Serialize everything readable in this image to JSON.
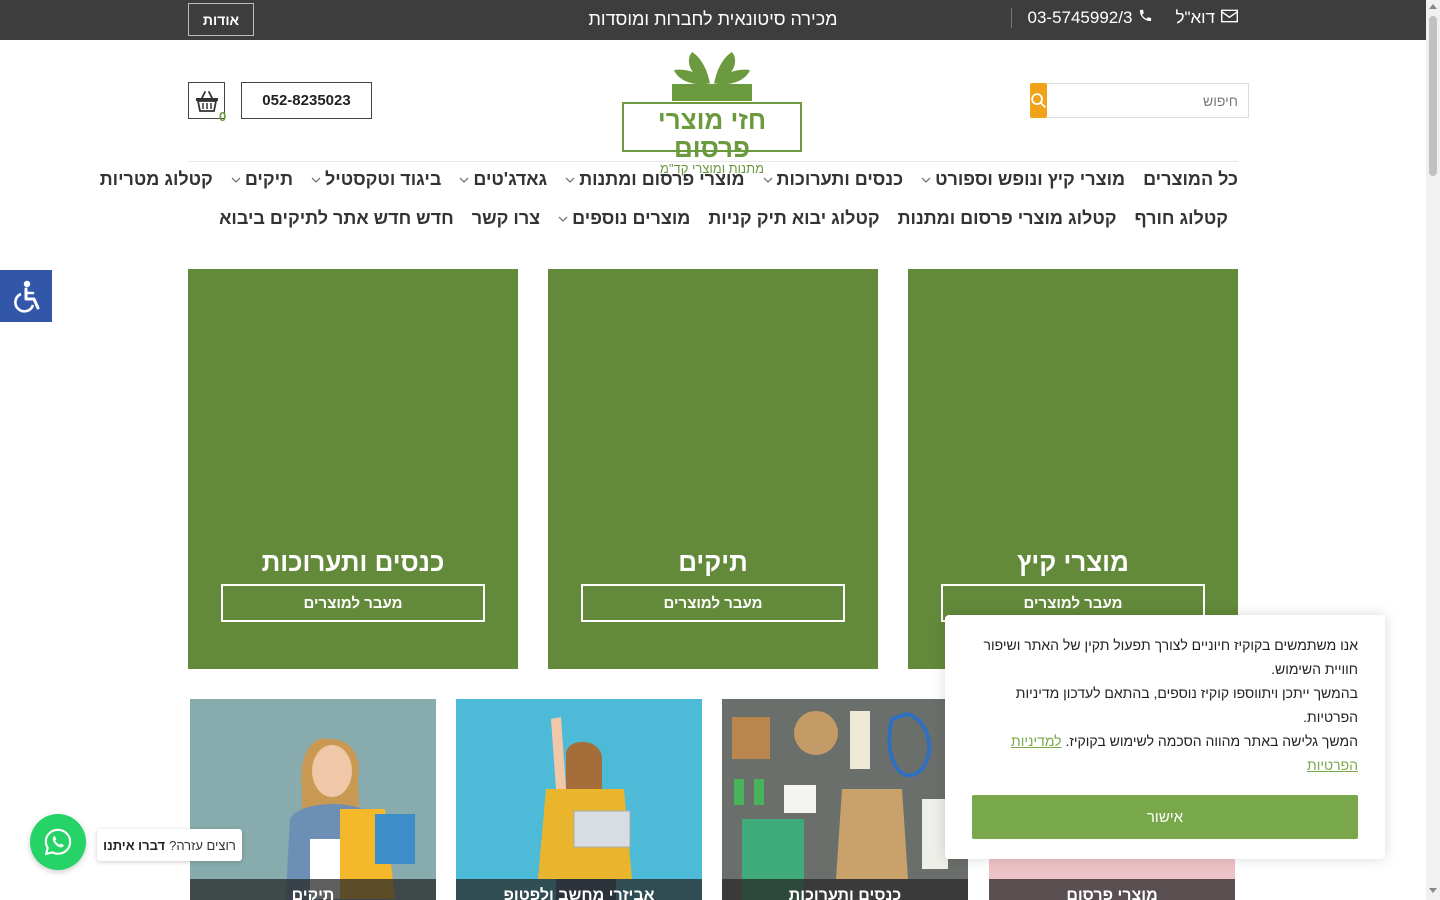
{
  "topbar": {
    "about_label": "אודות",
    "tagline": "מכירה סיטונאית לחברות ומוסדות",
    "phone": "03-5745992/3",
    "email_label": "דוא\"ל"
  },
  "header": {
    "search_placeholder": "חיפוש",
    "logo_main": "חזי מוצרי פרסום",
    "logo_sub": "מתנות ומוצרי קד\"מ",
    "phone": "052-8235023",
    "cart_count": "0"
  },
  "nav": {
    "row1": [
      {
        "label": "כל המוצרים",
        "dropdown": false
      },
      {
        "label": "מוצרי קיץ ונופש וספורט",
        "dropdown": true
      },
      {
        "label": "כנסים ותערוכות",
        "dropdown": true
      },
      {
        "label": "מוצרי פרסום ומתנות",
        "dropdown": true
      },
      {
        "label": "גאדג'טים",
        "dropdown": true
      },
      {
        "label": "ביגוד וטקסטיל",
        "dropdown": true
      },
      {
        "label": "תיקים",
        "dropdown": true
      },
      {
        "label": "קטלוג מטריות",
        "dropdown": false
      }
    ],
    "row2": [
      {
        "label": "קטלוג חורף",
        "dropdown": false
      },
      {
        "label": "קטלוג מוצרי פרסום ומתנות",
        "dropdown": false
      },
      {
        "label": "קטלוג יבוא תיק קניות",
        "dropdown": false
      },
      {
        "label": "מוצרים נוספים",
        "dropdown": true
      },
      {
        "label": "צרו קשר",
        "dropdown": false
      },
      {
        "label": "חדש חדש אתר לתיקים ביבוא",
        "dropdown": false
      }
    ]
  },
  "tiles": [
    {
      "title": "כנסים ותערוכות",
      "button": "מעבר למוצרים"
    },
    {
      "title": "תיקים",
      "button": "מעבר למוצרים"
    },
    {
      "title": "מוצרי קיץ",
      "button": "מעבר למוצרים"
    }
  ],
  "cards": [
    {
      "label": "תיקים"
    },
    {
      "label": "אביזרי מחשב ולפטופ"
    },
    {
      "label": "כנסים ותערוכות"
    },
    {
      "label": "מוצרי פרסום"
    }
  ],
  "cookie": {
    "line1": "אנו משתמשים בקוקיז חיוניים לצורך תפעול תקין של האתר ושיפור חוויית השימוש.",
    "line2": "בהמשך ייתכן ויתווספו קוקיז נוספים, בהתאם לעדכון מדיניות הפרטיות.",
    "line3": "המשך גלישה באתר מהווה הסכמה לשימוש בקוקיז.",
    "link": "למדיניות הפרטיות",
    "button": "אישור"
  },
  "whatsapp": {
    "question": "רוצים עזרה?",
    "cta": "דברו איתנו"
  },
  "colors": {
    "topbar": "#3d3d3d",
    "brand_green": "#638a3b",
    "search_orange": "#f0a21a",
    "accessibility_blue": "#3257a8",
    "whatsapp_green": "#25d366"
  }
}
